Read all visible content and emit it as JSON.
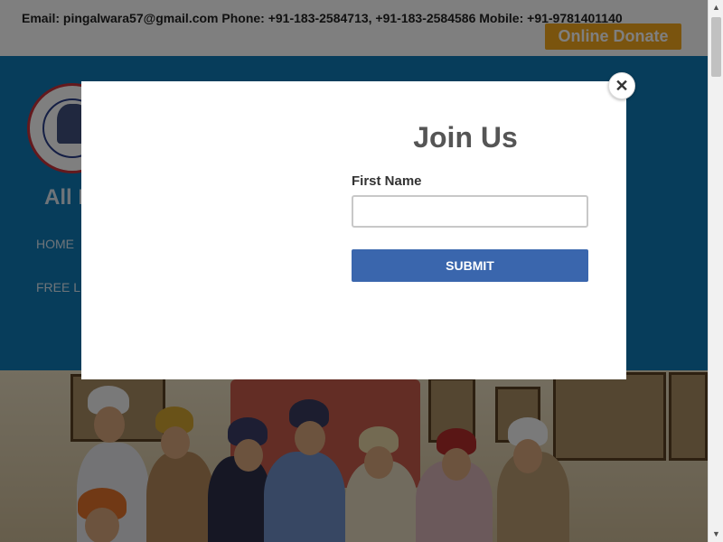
{
  "topbar": {
    "contact_text": "Email: pingalwara57@gmail.com Phone: +91-183-2584713, +91-183-2584586 Mobile: +91-9781401140",
    "donate_label": "Online Donate"
  },
  "header": {
    "site_name_visible": "All I",
    "nav": [
      "HOME",
      "FREE L"
    ]
  },
  "modal": {
    "title": "Join Us",
    "first_name_label": "First Name",
    "first_name_value": "",
    "first_name_placeholder": "",
    "submit_label": "SUBMIT",
    "close_glyph": "✕"
  },
  "scrollbar": {
    "up_glyph": "▲",
    "down_glyph": "▼"
  },
  "icons": {
    "close": "close-icon",
    "logo": "org-logo"
  },
  "colors": {
    "header_bg": "#0f7bb7",
    "donate_bg": "#f5a81c",
    "submit_bg": "#3a66ad",
    "overlay": "rgba(0,0,0,0.5)"
  }
}
